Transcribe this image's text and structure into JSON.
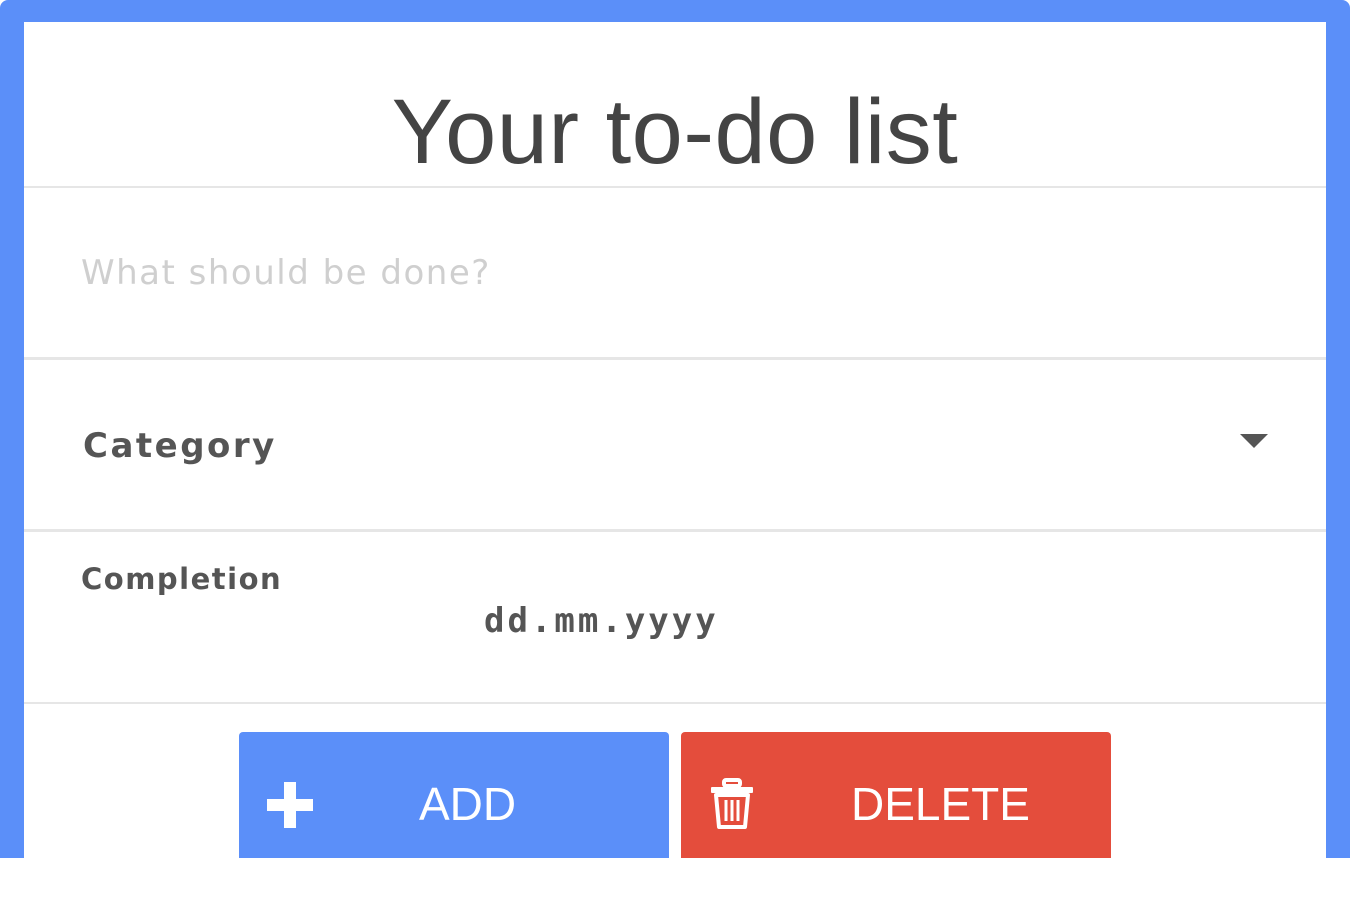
{
  "app": {
    "title": "Your to-do list"
  },
  "task": {
    "placeholder": "What should be done?",
    "value": ""
  },
  "category": {
    "label": "Category",
    "icon": "caret-down-icon"
  },
  "completion": {
    "label": "Completion",
    "date_placeholder": "dd.mm.yyyy"
  },
  "buttons": {
    "add_label": "ADD",
    "add_icon": "plus-icon",
    "delete_label": "DELETE",
    "delete_icon": "trash-icon"
  },
  "colors": {
    "accent": "#5b8ff9",
    "danger": "#e44d3c",
    "text": "#444444",
    "placeholder": "#cfcfcf",
    "divider": "#e6e6e6"
  }
}
